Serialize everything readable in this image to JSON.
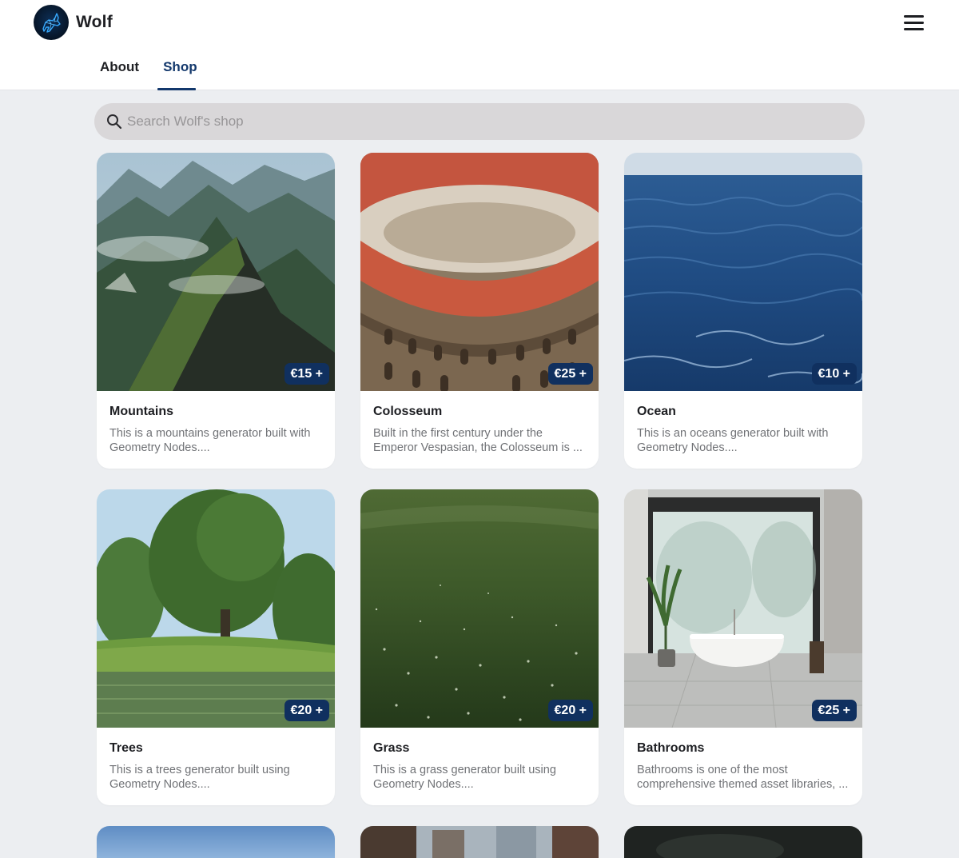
{
  "header": {
    "brand": "Wolf",
    "logo_icon": "wolf-logo",
    "menu_icon": "hamburger-menu-icon"
  },
  "tabs": [
    {
      "label": "About",
      "active": false
    },
    {
      "label": "Shop",
      "active": true
    }
  ],
  "colors": {
    "accent": "#13386c",
    "price_badge": "#10305f",
    "page_bg": "#eceef1",
    "search_bg": "#d9d7d9"
  },
  "search": {
    "placeholder": "Search Wolf's shop",
    "icon": "search-icon"
  },
  "products": [
    {
      "title": "Mountains",
      "price": "€15 +",
      "description": "This is a mountains generator built with Geometry Nodes...."
    },
    {
      "title": "Colosseum",
      "price": "€25 +",
      "description": "Built in the first century under the Emperor Vespasian, the Colosseum is ..."
    },
    {
      "title": "Ocean",
      "price": "€10 +",
      "description": "This is an oceans generator built with Geometry Nodes...."
    },
    {
      "title": "Trees",
      "price": "€20 +",
      "description": "This is a trees generator built using Geometry Nodes...."
    },
    {
      "title": "Grass",
      "price": "€20 +",
      "description": "This is a grass generator built using Geometry Nodes...."
    },
    {
      "title": "Bathrooms",
      "price": "€25 +",
      "description": "Bathrooms is one of the most comprehensive themed asset libraries, ..."
    }
  ]
}
